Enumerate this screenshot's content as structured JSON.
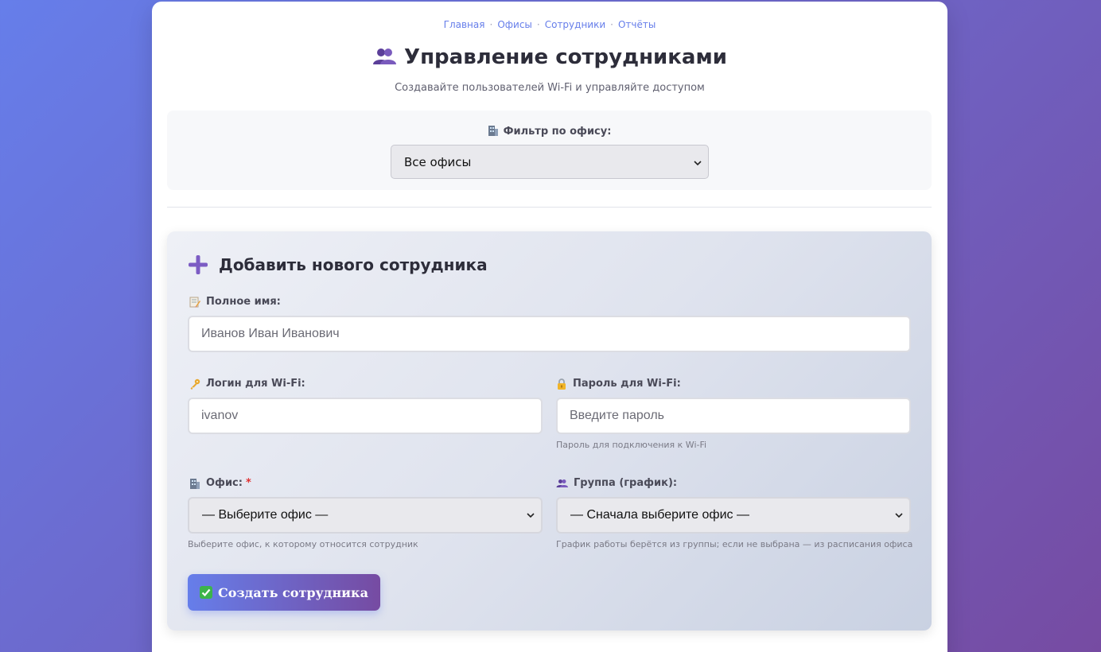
{
  "nav": {
    "links": [
      "Главная",
      "Офисы",
      "Сотрудники",
      "Отчёты"
    ]
  },
  "header": {
    "title": "Управление сотрудниками",
    "title_icon": "people-icon",
    "subtitle": "Создавайте пользователей Wi-Fi и управляйте доступом"
  },
  "filter": {
    "label": "Фильтр по офису:",
    "icon": "office-building-icon",
    "selected": "Все офисы"
  },
  "form": {
    "title": "Добавить нового сотрудника",
    "title_icon": "plus-icon",
    "full_name": {
      "label": "Полное имя:",
      "icon": "memo-icon",
      "placeholder": "Иванов Иван Иванович"
    },
    "login": {
      "label": "Логин для Wi-Fi:",
      "icon": "key-icon",
      "placeholder": "ivanov"
    },
    "password": {
      "label": "Пароль для Wi-Fi:",
      "icon": "lock-icon",
      "placeholder": "Введите пароль",
      "hint": "Пароль для подключения к Wi-Fi"
    },
    "office": {
      "label": "Офис:",
      "required_mark": "*",
      "icon": "office-building-icon",
      "selected": "— Выберите офис —",
      "hint": "Выберите офис, к которому относится сотрудник"
    },
    "group": {
      "label": "Группа (график):",
      "icon": "people-icon",
      "selected": "— Сначала выберите офис —",
      "hint": "График работы берётся из группы; если не выбрана — из расписания офиса"
    },
    "submit": {
      "label": "Создать сотрудника",
      "icon": "check-mark-icon"
    }
  },
  "colors": {
    "accent": "#667eea",
    "accent_end": "#764ba2",
    "required": "#e03131"
  }
}
